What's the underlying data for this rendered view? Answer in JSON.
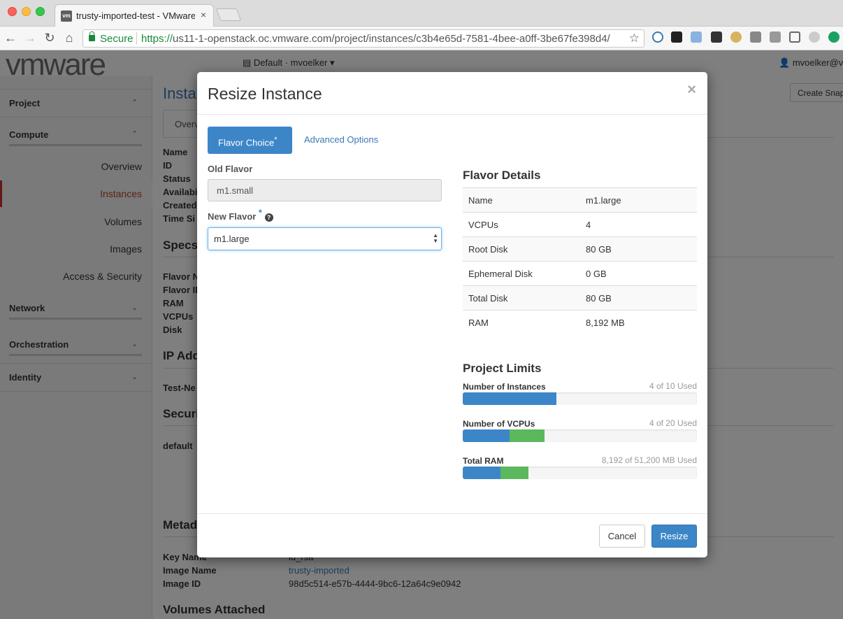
{
  "browser": {
    "tab_title": "trusty-imported-test - VMware",
    "favicon_text": "vm",
    "secure_label": "Secure",
    "url_scheme": "https://",
    "url_host": "us11-1-openstack.oc.vmware.com",
    "url_path": "/project/instances/c3b4e65d-7581-4bee-a0ff-3be67fe398d4/"
  },
  "header": {
    "logo": "vmware",
    "project_selector": "Default · mvoelker",
    "user_menu": "mvoelker@vm",
    "create_snapshot": "Create Snap"
  },
  "sidebar": {
    "project": "Project",
    "compute": "Compute",
    "items": [
      "Overview",
      "Instances",
      "Volumes",
      "Images",
      "Access & Security"
    ],
    "network": "Network",
    "orchestration": "Orchestration",
    "identity": "Identity"
  },
  "main": {
    "title": "Insta",
    "tab": "Overv",
    "overview_labels": [
      "Name",
      "ID",
      "Status",
      "Availabi",
      "Created",
      "Time Si"
    ],
    "specs_heading": "Specs",
    "specs_labels": [
      "Flavor N",
      "Flavor ID",
      "RAM",
      "VCPUs",
      "Disk"
    ],
    "ip_heading": "IP Add",
    "network_label": "Test-Ne",
    "security_heading": "Securi",
    "security_value": "default",
    "metadata_heading": "Metad",
    "key_name_label": "Key Name",
    "key_name_value": "id_rsa",
    "image_name_label": "Image Name",
    "image_name_value": "trusty-imported",
    "image_id_label": "Image ID",
    "image_id_value": "98d5c514-e57b-4444-9bc6-12a64c9e0942",
    "volumes_heading": "Volumes Attached"
  },
  "modal": {
    "title": "Resize Instance",
    "close": "×",
    "tabs": {
      "flavor_choice": "Flavor Choice",
      "advanced_options": "Advanced Options"
    },
    "required_mark": "*",
    "old_flavor_label": "Old Flavor",
    "old_flavor_value": "m1.small",
    "new_flavor_label": "New Flavor",
    "new_flavor_value": "m1.large",
    "help_glyph": "?",
    "flavor_details_title": "Flavor Details",
    "flavor_details": [
      {
        "label": "Name",
        "value": "m1.large"
      },
      {
        "label": "VCPUs",
        "value": "4"
      },
      {
        "label": "Root Disk",
        "value": "80 GB"
      },
      {
        "label": "Ephemeral Disk",
        "value": "0 GB"
      },
      {
        "label": "Total Disk",
        "value": "80 GB"
      },
      {
        "label": "RAM",
        "value": "8,192 MB"
      }
    ],
    "project_limits_title": "Project Limits",
    "limits": [
      {
        "label": "Number of Instances",
        "used_text": "4 of 10 Used",
        "current_fraction": 0.4,
        "added_fraction": 0.0
      },
      {
        "label": "Number of VCPUs",
        "used_text": "4 of 20 Used",
        "current_fraction": 0.2,
        "added_fraction": 0.15
      },
      {
        "label": "Total RAM",
        "used_text": "8,192 of 51,200 MB Used",
        "current_fraction": 0.16,
        "added_fraction": 0.12
      }
    ],
    "colors": {
      "current": "#3c86c8",
      "added": "#5cb85c",
      "primary": "#3c86c8"
    },
    "cancel_label": "Cancel",
    "resize_label": "Resize"
  }
}
